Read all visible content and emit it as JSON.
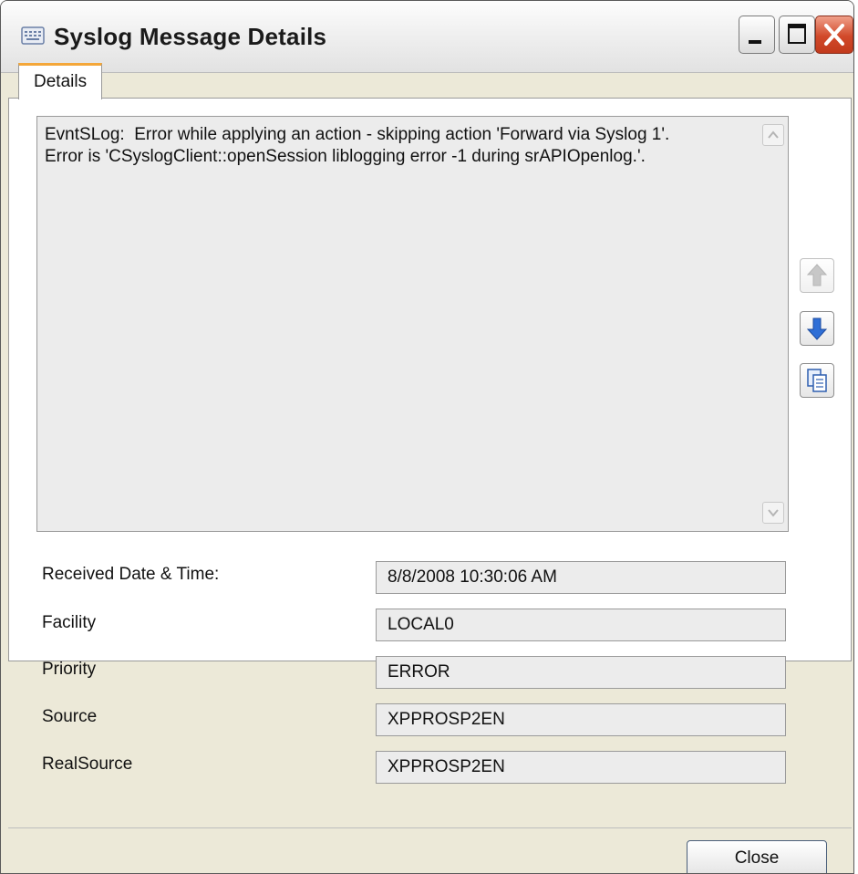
{
  "window": {
    "title": "Syslog Message Details",
    "icon": "keyboard-icon",
    "controls": [
      "minimize-icon",
      "maximize-icon",
      "close-icon"
    ]
  },
  "tabs": [
    {
      "label": "Details",
      "active": true
    }
  ],
  "message": {
    "text": "EvntSLog:  Error while applying an action - skipping action 'Forward via Syslog 1'.\nError is 'CSyslogClient::openSession liblogging error -1 during srAPIOpenlog.'."
  },
  "side_buttons": [
    "arrow-up-icon",
    "arrow-down-icon",
    "copy-icon"
  ],
  "fields": [
    {
      "label": "Received Date & Time:",
      "value": "8/8/2008 10:30:06 AM"
    },
    {
      "label": "Facility",
      "value": "LOCAL0"
    },
    {
      "label": "Priority",
      "value": "ERROR"
    },
    {
      "label": "Source",
      "value": "XPPROSP2EN"
    },
    {
      "label": "RealSource",
      "value": "XPPROSP2EN"
    }
  ],
  "footer": {
    "close_label": "Close"
  },
  "colors": {
    "tab_highlight": "#f4a73a",
    "close_button": "#d1492a",
    "arrow_blue": "#2f6fd6"
  }
}
